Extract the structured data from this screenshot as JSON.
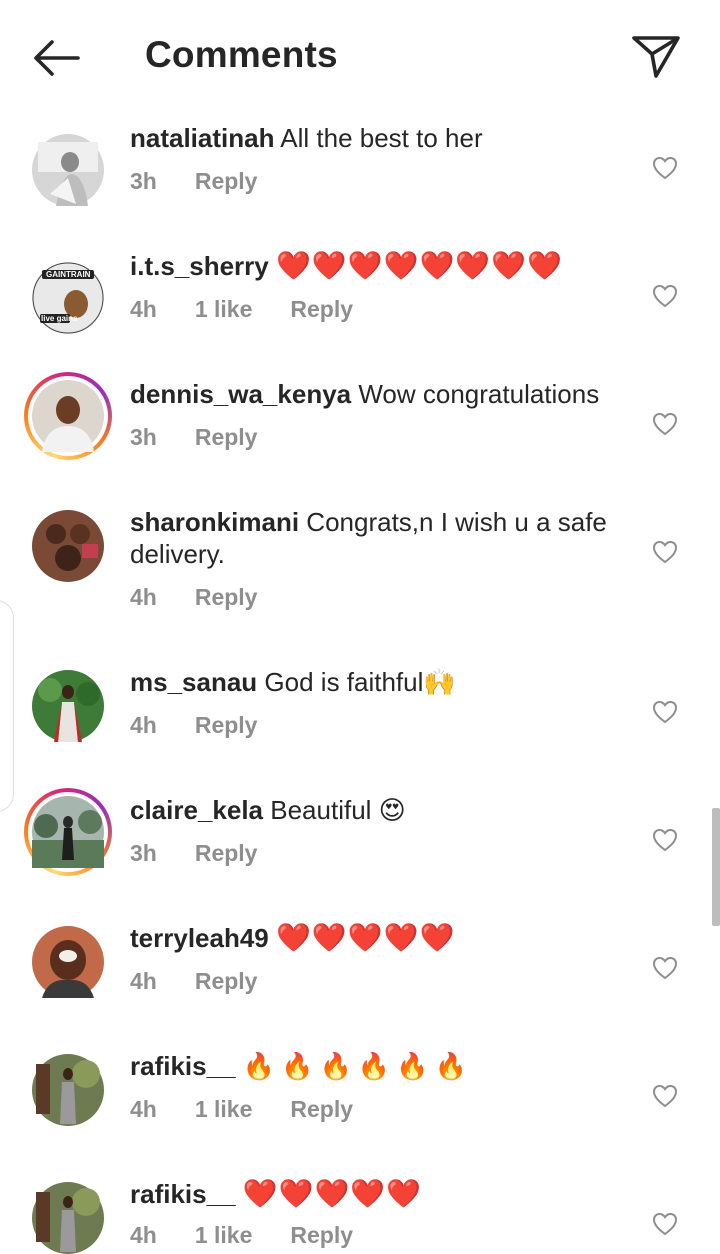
{
  "header": {
    "title": "Comments"
  },
  "comments": [
    {
      "username": "nataliatinah",
      "text": "All the best to her",
      "time": "3h",
      "likes": "",
      "reply": "Reply",
      "story": false,
      "avatar_color": "#cfcfcf"
    },
    {
      "username": "i.t.s_sherry",
      "text": "❤️❤️❤️❤️❤️❤️❤️❤️",
      "time": "4h",
      "likes": "1 like",
      "reply": "Reply",
      "story": false,
      "avatar_color": "#e6e6e6",
      "avatar_badge_top": "GAINTRAIN",
      "avatar_badge_bottom": "live gains"
    },
    {
      "username": "dennis_wa_kenya",
      "text": "Wow congratulations",
      "time": "3h",
      "likes": "",
      "reply": "Reply",
      "story": true,
      "avatar_color": "#a77a5a"
    },
    {
      "username": "sharonkimani",
      "text": "Congrats,n I wish u a safe delivery.",
      "time": "4h",
      "likes": "",
      "reply": "Reply",
      "story": false,
      "avatar_color": "#6b3b2a"
    },
    {
      "username": "ms_sanau",
      "text": "God is faithful🙌",
      "time": "4h",
      "likes": "",
      "reply": "Reply",
      "story": false,
      "avatar_color": "#3f7a3a"
    },
    {
      "username": "claire_kela",
      "text": "Beautiful 😍",
      "time": "3h",
      "likes": "",
      "reply": "Reply",
      "story": true,
      "avatar_color": "#6f8a7a"
    },
    {
      "username": "terryleah49",
      "text": "❤️❤️❤️❤️❤️",
      "time": "4h",
      "likes": "",
      "reply": "Reply",
      "story": false,
      "avatar_color": "#9a5a3a"
    },
    {
      "username": "rafikis__",
      "text": "🔥🔥🔥🔥🔥🔥",
      "time": "4h",
      "likes": "1 like",
      "reply": "Reply",
      "story": false,
      "avatar_color": "#6e7b52"
    },
    {
      "username": "rafikis__",
      "text": "❤️❤️❤️❤️❤️",
      "time": "4h",
      "likes": "1 like",
      "reply": "Reply",
      "story": false,
      "avatar_color": "#6e7b52"
    }
  ],
  "icons": {
    "back": "arrow-left-icon",
    "send": "paper-plane-icon",
    "like": "heart-outline-icon"
  }
}
